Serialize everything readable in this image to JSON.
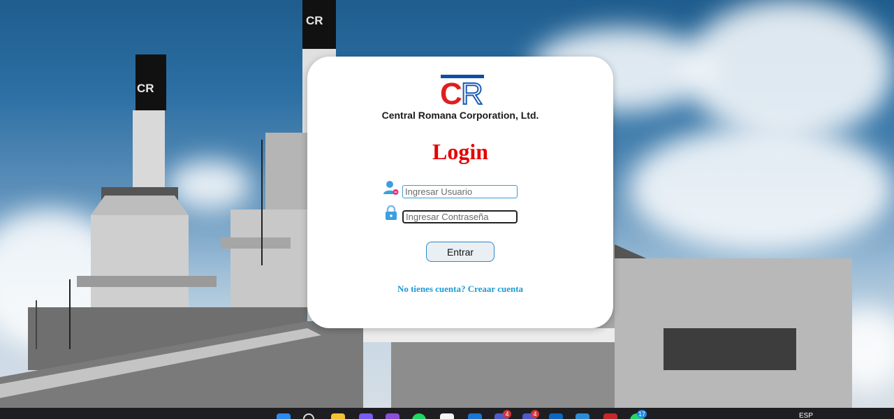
{
  "card": {
    "logo_letter_c": "C",
    "logo_letter_r": "R",
    "company_name": "Central Romana Corporation, Ltd.",
    "title": "Login",
    "username_placeholder": "Ingresar Usuario",
    "password_placeholder": "Ingresar Contraseña",
    "enter_label": "Entrar",
    "signup_prompt": "No tienes cuenta?",
    "signup_link": "Creaar cuenta"
  },
  "scene": {
    "chimney_label": "CR"
  },
  "taskbar": {
    "icons": [
      "windows-start-icon",
      "search-icon",
      "file-explorer-icon",
      "copilot-icon",
      "visual-studio-icon",
      "spotify-icon",
      "capcut-icon",
      "outlook-icon",
      "teams-icon",
      "teams-icon",
      "mail-icon",
      "vscode-icon",
      "excel-icon",
      "whatsapp-icon"
    ],
    "badge_1": "4",
    "badge_2": "4",
    "badge_3": "17",
    "language": "ESP"
  },
  "colors": {
    "title_red": "#e60000",
    "link_blue": "#1e9ad6",
    "logo_blue": "#0d4fa3",
    "logo_red": "#e01e1e"
  }
}
